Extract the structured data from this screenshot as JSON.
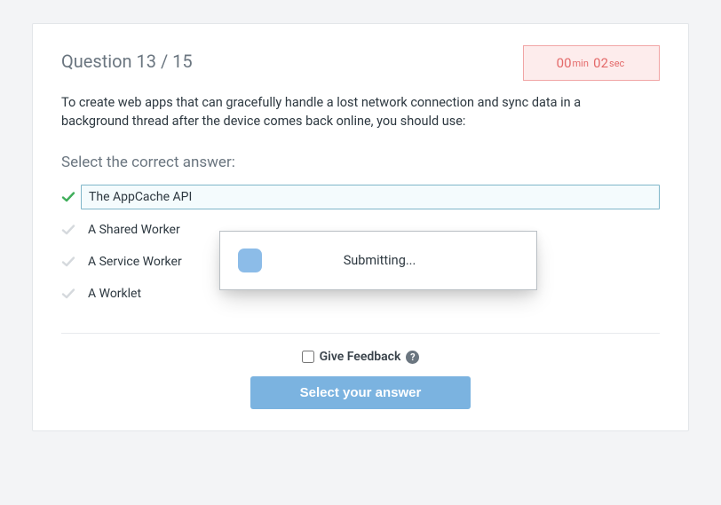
{
  "header": {
    "question_label": "Question 13 / 15"
  },
  "timer": {
    "min_value": "00",
    "min_unit": "min",
    "sec_value": "02",
    "sec_unit": "sec"
  },
  "question": {
    "text": "To create web apps that can gracefully handle a lost network connection and sync data in a background thread after the device comes back online, you should use:"
  },
  "prompt": "Select the correct answer:",
  "options": [
    {
      "label": "The AppCache API",
      "selected": true
    },
    {
      "label": "A Shared Worker",
      "selected": false
    },
    {
      "label": "A Service Worker",
      "selected": false
    },
    {
      "label": "A Worklet",
      "selected": false
    }
  ],
  "footer": {
    "feedback_label": "Give Feedback",
    "submit_label": "Select your answer"
  },
  "modal": {
    "text": "Submitting..."
  }
}
